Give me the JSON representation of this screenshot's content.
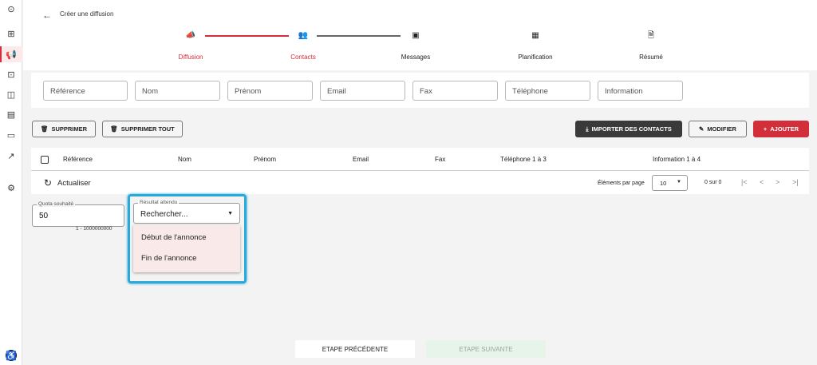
{
  "colors": {
    "accent": "#d32f3a",
    "accent_light": "#fde9ea",
    "highlight": "#29a9d8",
    "dark_button": "#3a3a3a",
    "next_button_bg": "#e6f4ea"
  },
  "rail": {
    "icons": [
      "chevron-circle-icon",
      "grid-icon",
      "megaphone-icon",
      "inbox-icon",
      "package-icon",
      "calendar-icon",
      "message-icon",
      "trend-icon",
      "settings-icon",
      "accessibility-icon"
    ]
  },
  "header": {
    "title": "Créer une diffusion"
  },
  "steps": [
    {
      "label": "Diffusion",
      "icon": "megaphone-icon",
      "state": "done"
    },
    {
      "label": "Contacts",
      "icon": "users-icon",
      "state": "active"
    },
    {
      "label": "Messages",
      "icon": "message-icon",
      "state": "todo"
    },
    {
      "label": "Planification",
      "icon": "calendar-icon",
      "state": "todo"
    },
    {
      "label": "Résumé",
      "icon": "document-search-icon",
      "state": "todo"
    }
  ],
  "filters": [
    "Référence",
    "Nom",
    "Prénom",
    "Email",
    "Fax",
    "Téléphone",
    "Information"
  ],
  "actions": {
    "delete": "SUPPRIMER",
    "delete_all": "SUPPRIMER TOUT",
    "import": "IMPORTER DES CONTACTS",
    "edit": "MODIFIER",
    "add": "AJOUTER"
  },
  "table": {
    "columns": [
      "Référence",
      "Nom",
      "Prénom",
      "Email",
      "Fax",
      "Téléphone 1 à 3",
      "Information 1 à 4"
    ],
    "refresh": "Actualiser",
    "per_page_label": "Éléments par page",
    "per_page_value": "10",
    "range": "0 sur 0"
  },
  "quota": {
    "label": "Quota souhaité",
    "value": "50",
    "hint": "1 - 1000000000"
  },
  "result": {
    "label": "Résultat attendu",
    "value": "Rechercher...",
    "options": [
      "Début de l'annonce",
      "Fin de l'annonce"
    ]
  },
  "footer": {
    "prev": "ETAPE PRÉCÉDENTE",
    "next": "ETAPE SUIVANTE"
  }
}
